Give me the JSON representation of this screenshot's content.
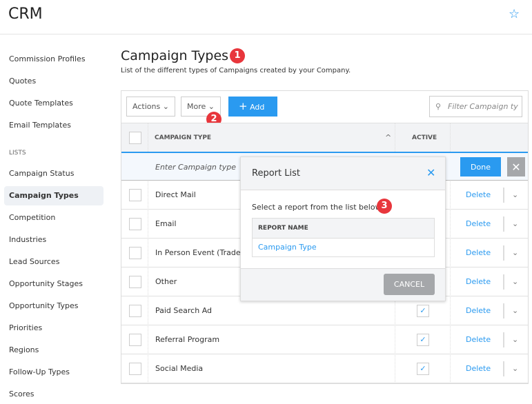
{
  "header": {
    "title": "CRM",
    "favorite_icon": "star-icon"
  },
  "sidebar": {
    "items": [
      {
        "label": "Commission Profiles"
      },
      {
        "label": "Quotes"
      },
      {
        "label": "Quote Templates"
      },
      {
        "label": "Email Templates"
      },
      {
        "label": "LISTS"
      },
      {
        "label": "Campaign Status"
      },
      {
        "label": "Campaign Types"
      },
      {
        "label": "Competition"
      },
      {
        "label": "Industries"
      },
      {
        "label": "Lead Sources"
      },
      {
        "label": "Opportunity Stages"
      },
      {
        "label": "Opportunity Types"
      },
      {
        "label": "Priorities"
      },
      {
        "label": "Regions"
      },
      {
        "label": "Follow-Up Types"
      },
      {
        "label": "Scores"
      }
    ]
  },
  "page": {
    "title": "Campaign Types",
    "subtitle": "List of the different types of Campaigns created by your Company."
  },
  "badges": [
    "1",
    "2",
    "3"
  ],
  "toolbar": {
    "actions": "Actions",
    "more": "More",
    "add": "Add",
    "filter_placeholder": "Filter Campaign ty"
  },
  "table": {
    "col_type": "CAMPAIGN TYPE",
    "col_active": "ACTIVE",
    "new_placeholder": "Enter Campaign type",
    "done": "Done",
    "rows": [
      {
        "name": "Direct Mail",
        "active": false,
        "action": "Delete"
      },
      {
        "name": "Email",
        "active": false,
        "action": "Delete"
      },
      {
        "name": "In Person Event (Trades",
        "active": false,
        "action": "Delete"
      },
      {
        "name": "Other",
        "active": false,
        "action": "Delete"
      },
      {
        "name": "Paid Search Ad",
        "active": true,
        "action": "Delete"
      },
      {
        "name": "Referral Program",
        "active": true,
        "action": "Delete"
      },
      {
        "name": "Social Media",
        "active": true,
        "action": "Delete"
      }
    ]
  },
  "modal": {
    "title": "Report List",
    "instruction": "Select a report from the list below",
    "col": "REPORT NAME",
    "reports": [
      "Campaign Type"
    ],
    "cancel": "CANCEL"
  }
}
